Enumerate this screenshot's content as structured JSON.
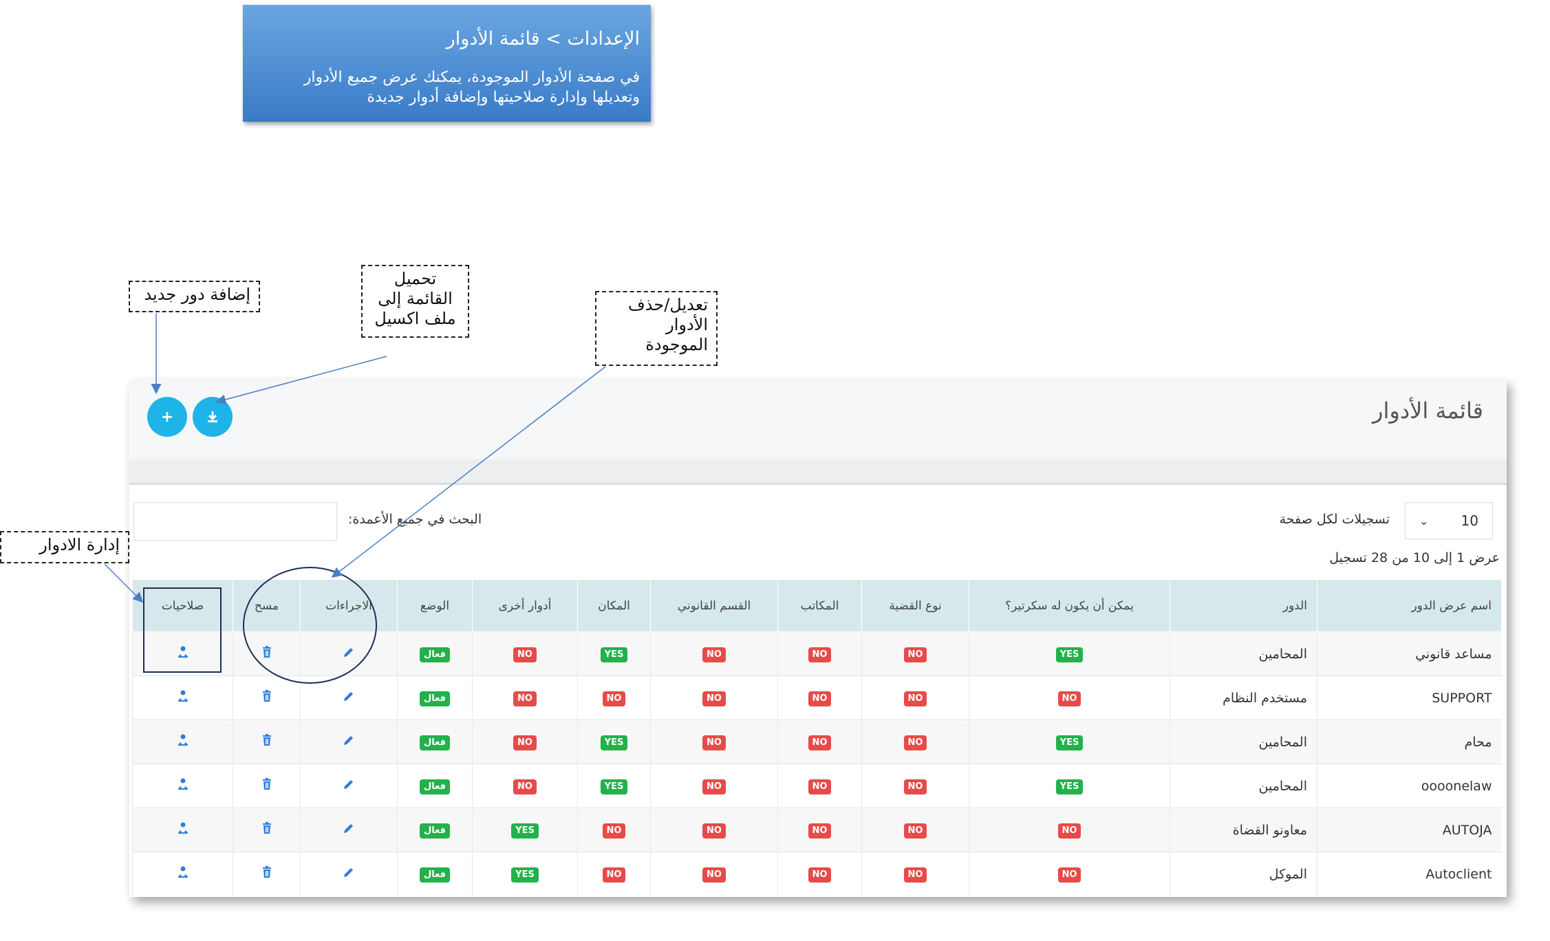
{
  "header_callout": {
    "title": "الإعدادات > قائمة الأدوار",
    "desc_line1": "في صفحة الأدوار الموجودة، يمكنك عرض جميع الأدوار",
    "desc_line2": "وتعديلها وإدارة صلاحيتها وإضافة أدوار جديدة"
  },
  "annotations": {
    "add_role": "إضافة دور جديد",
    "export_line1": "تحميل",
    "export_line2": "القائمة إلى",
    "export_line3": "ملف اكسيل",
    "edit_line1": "تعديل/حذف",
    "edit_line2": "الأدوار",
    "edit_line3": "الموجودة",
    "manage_roles": "إدارة الادوار"
  },
  "panel": {
    "title": "قائمة الأدوار",
    "add_icon": "plus-icon",
    "download_icon": "download-icon"
  },
  "controls": {
    "page_length_value": "10",
    "page_length_label": "تسجيلات لكل صفحة",
    "search_label": "البحث في جميع الأعمدة:",
    "search_value": "",
    "info": "عرض 1 إلى 10 من 28 تسجيل"
  },
  "table": {
    "headers": [
      "اسم عرض الدور",
      "الدور",
      "يمكن أن يكون له سكرتير؟",
      "نوع القضية",
      "المكاتب",
      "القسم القانوني",
      "المكان",
      "أدوار أخرى",
      "الوضع",
      "الاجراءات",
      "مسح",
      "صلاحيات"
    ],
    "rows": [
      {
        "display_name": "مساعد قانوني",
        "role": "المحامين",
        "secretary": "YES",
        "case_type": "NO",
        "offices": "NO",
        "legal_dept": "NO",
        "place": "YES",
        "other_roles": "NO",
        "status": "فعال"
      },
      {
        "display_name": "SUPPORT",
        "role": "مستخدم النظام",
        "secretary": "NO",
        "case_type": "NO",
        "offices": "NO",
        "legal_dept": "NO",
        "place": "NO",
        "other_roles": "NO",
        "status": "فعال"
      },
      {
        "display_name": "محام",
        "role": "المحامين",
        "secretary": "YES",
        "case_type": "NO",
        "offices": "NO",
        "legal_dept": "NO",
        "place": "YES",
        "other_roles": "NO",
        "status": "فعال"
      },
      {
        "display_name": "oooonelaw",
        "role": "المحامين",
        "secretary": "YES",
        "case_type": "NO",
        "offices": "NO",
        "legal_dept": "NO",
        "place": "YES",
        "other_roles": "NO",
        "status": "فعال"
      },
      {
        "display_name": "AUTOJA",
        "role": "معاونو القضاة",
        "secretary": "NO",
        "case_type": "NO",
        "offices": "NO",
        "legal_dept": "NO",
        "place": "NO",
        "other_roles": "YES",
        "status": "فعال"
      },
      {
        "display_name": "Autoclient",
        "role": "الموكل",
        "secretary": "NO",
        "case_type": "NO",
        "offices": "NO",
        "legal_dept": "NO",
        "place": "NO",
        "other_roles": "YES",
        "status": "فعال"
      }
    ]
  },
  "colors": {
    "accent": "#1fb4e8",
    "yes": "#22b24c",
    "no": "#e84a4a",
    "header_row": "#d6e8ec",
    "callout": "#4a8bd4"
  }
}
